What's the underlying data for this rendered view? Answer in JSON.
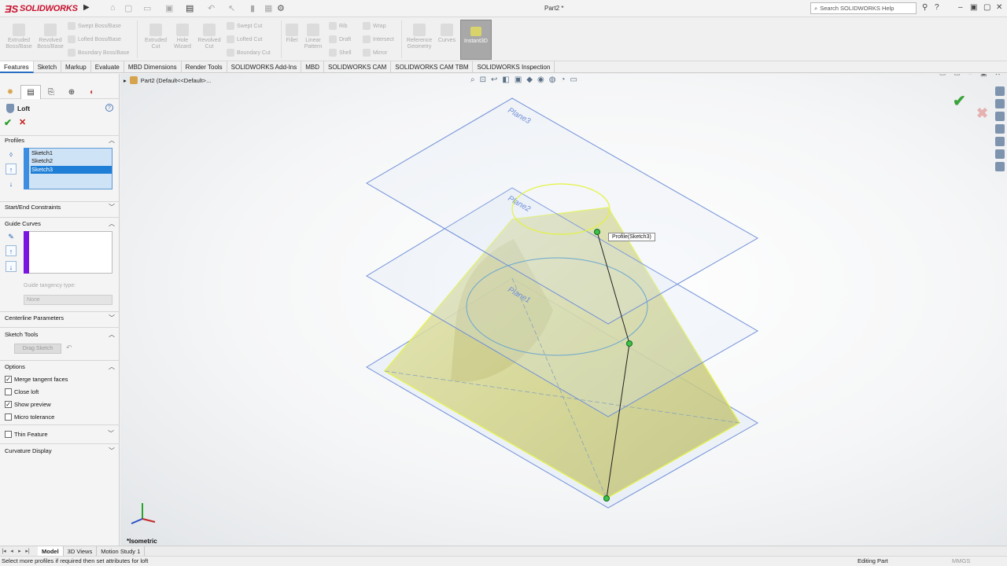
{
  "app": {
    "brand": "SOLIDWORKS",
    "document_title": "Part2 *",
    "search_placeholder": "Search SOLIDWORKS Help"
  },
  "ribbon": {
    "big_buttons": [
      {
        "label": "Extruded Boss/Base",
        "line1": "Extruded",
        "line2": "Boss/Base"
      },
      {
        "label": "Revolved Boss/Base",
        "line1": "Revolved",
        "line2": "Boss/Base"
      },
      {
        "label": "Extruded Cut",
        "line1": "Extruded",
        "line2": "Cut"
      },
      {
        "label": "Hole Wizard",
        "line1": "Hole",
        "line2": "Wizard"
      },
      {
        "label": "Revolved Cut",
        "line1": "Revolved",
        "line2": "Cut"
      },
      {
        "label": "Fillet",
        "line1": "Fillet",
        "line2": ""
      },
      {
        "label": "Linear Pattern",
        "line1": "Linear",
        "line2": "Pattern"
      },
      {
        "label": "Reference Geometry",
        "line1": "Reference",
        "line2": "Geometry"
      },
      {
        "label": "Curves",
        "line1": "Curves",
        "line2": ""
      }
    ],
    "small_buttons": {
      "swept_boss": "Swept Boss/Base",
      "lofted_boss": "Lofted Boss/Base",
      "boundary_boss": "Boundary Boss/Base",
      "swept_cut": "Swept Cut",
      "lofted_cut": "Lofted Cut",
      "boundary_cut": "Boundary Cut",
      "rib": "Rib",
      "draft": "Draft",
      "shell": "Shell",
      "wrap": "Wrap",
      "intersect": "Intersect",
      "mirror": "Mirror"
    },
    "instant3d": "Instant3D"
  },
  "tabs": [
    "Features",
    "Sketch",
    "Markup",
    "Evaluate",
    "MBD Dimensions",
    "Render Tools",
    "SOLIDWORKS Add-Ins",
    "MBD",
    "SOLIDWORKS CAM",
    "SOLIDWORKS CAM TBM",
    "SOLIDWORKS Inspection"
  ],
  "property_manager": {
    "title": "Loft",
    "help": "?",
    "groups": {
      "profiles": "Profiles",
      "start_end": "Start/End Constraints",
      "guide_curves": "Guide Curves",
      "guide_tangency_label": "Guide tangency type:",
      "guide_tangency_value": "None",
      "centerline": "Centerline Parameters",
      "sketch_tools": "Sketch Tools",
      "drag_sketch": "Drag Sketch",
      "options": "Options",
      "thin_feature": "Thin Feature",
      "curvature_display": "Curvature Display"
    },
    "profiles": [
      {
        "name": "Sketch1",
        "selected": false
      },
      {
        "name": "Sketch2",
        "selected": false
      },
      {
        "name": "Sketch3",
        "selected": true
      }
    ],
    "options": [
      {
        "label": "Merge tangent faces",
        "checked": true
      },
      {
        "label": "Close loft",
        "checked": false
      },
      {
        "label": "Show preview",
        "checked": true
      },
      {
        "label": "Micro tolerance",
        "checked": false
      }
    ]
  },
  "graphics": {
    "breadcrumb": "Part2  (Default<<Default>...",
    "planes": [
      "Plane3",
      "Plane2",
      "Plane1"
    ],
    "tooltip": "Profile(Sketch3)",
    "view_label": "*Isometric"
  },
  "bottom_tabs": [
    "Model",
    "3D Views",
    "Motion Study 1"
  ],
  "status": {
    "message": "Select more profiles if required then set attributes for loft",
    "mode": "Editing Part",
    "units": "MMGS"
  },
  "colors": {
    "brand_red": "#c8102e",
    "accent_blue": "#1f7fd6",
    "plane_edge": "#6f8fd8",
    "loft_fill": "#d9da8e",
    "loft_edge": "#e3f33a",
    "ok_green": "#2a9d2a",
    "cancel_red": "#c41818"
  }
}
